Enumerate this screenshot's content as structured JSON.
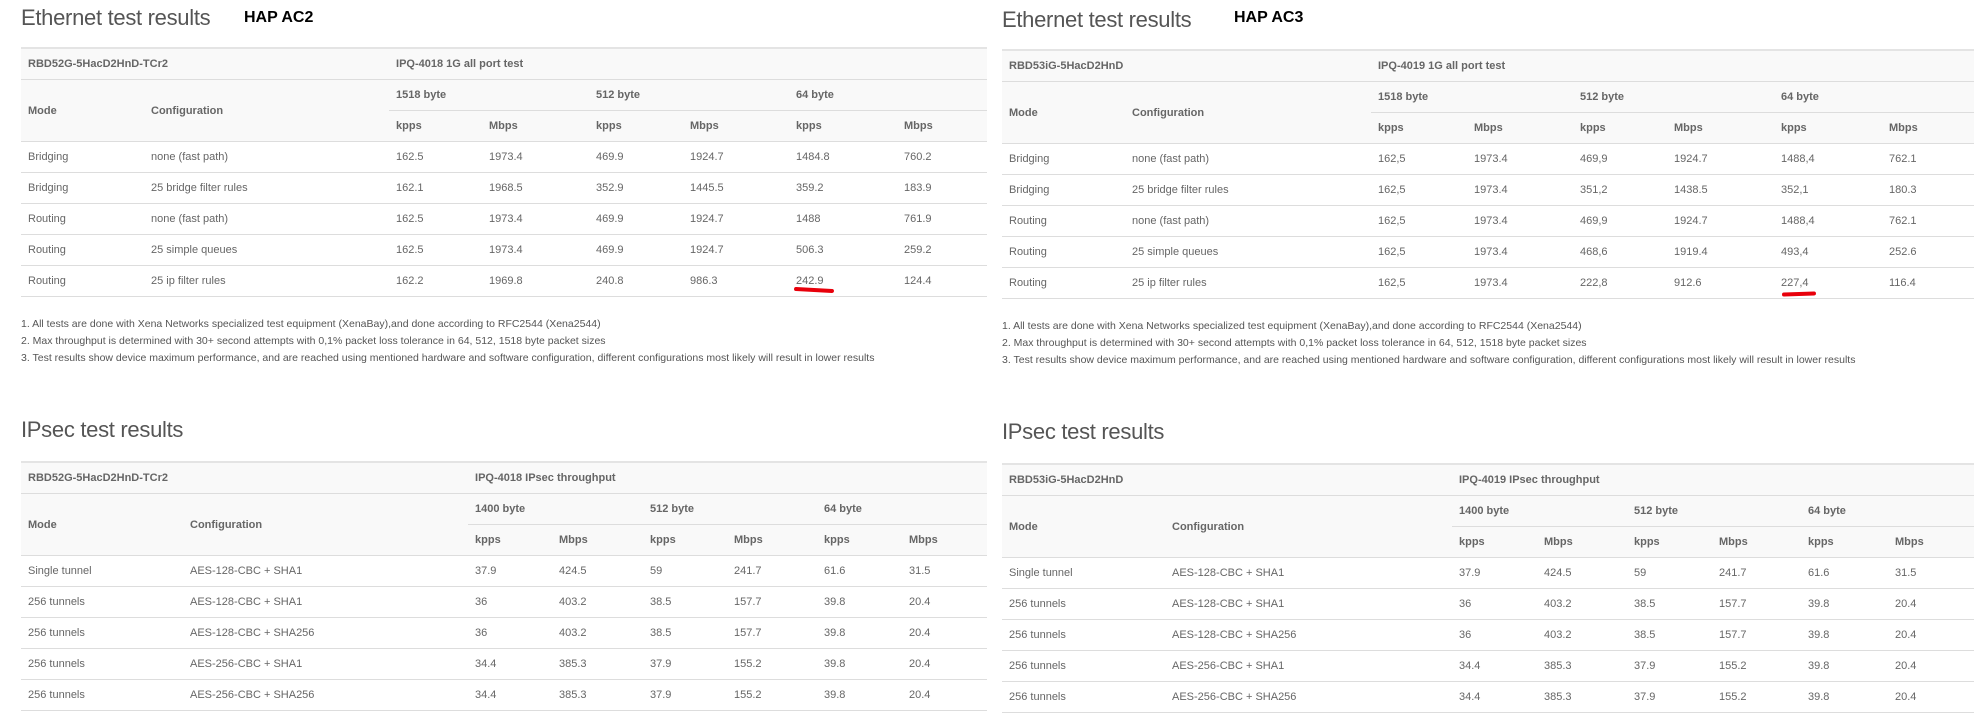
{
  "panels": [
    {
      "ethernet": {
        "title": "Ethernet test results",
        "model_label": "HAP AC2",
        "board": "RBD52G-5HacD2HnD-TCr2",
        "test_name": "IPQ-4018 1G all port test",
        "mode_header": "Mode",
        "config_header": "Configuration",
        "groups": [
          "1518 byte",
          "512 byte",
          "64 byte"
        ],
        "units": [
          "kpps",
          "Mbps",
          "kpps",
          "Mbps",
          "kpps",
          "Mbps"
        ],
        "rows": [
          [
            "Bridging",
            "none (fast path)",
            "162.5",
            "1973.4",
            "469.9",
            "1924.7",
            "1484.8",
            "760.2"
          ],
          [
            "Bridging",
            "25 bridge filter rules",
            "162.1",
            "1968.5",
            "352.9",
            "1445.5",
            "359.2",
            "183.9"
          ],
          [
            "Routing",
            "none (fast path)",
            "162.5",
            "1973.4",
            "469.9",
            "1924.7",
            "1488",
            "761.9"
          ],
          [
            "Routing",
            "25 simple queues",
            "162.5",
            "1973.4",
            "469.9",
            "1924.7",
            "506.3",
            "259.2"
          ],
          [
            "Routing",
            "25 ip filter rules",
            "162.2",
            "1969.8",
            "240.8",
            "986.3",
            "242.9",
            "124.4"
          ]
        ],
        "notes": [
          "1. All tests are done with Xena Networks specialized test equipment (XenaBay),and done according to RFC2544 (Xena2544)",
          "2. Max throughput is determined with 30+ second attempts with 0,1% packet loss tolerance in 64, 512, 1518 byte packet sizes",
          "3. Test results show device maximum performance, and are reached using mentioned hardware and software configuration, different configurations most likely will result in lower results"
        ]
      },
      "ipsec": {
        "title": "IPsec test results",
        "board": "RBD52G-5HacD2HnD-TCr2",
        "test_name": "IPQ-4018 IPsec throughput",
        "mode_header": "Mode",
        "config_header": "Configuration",
        "groups": [
          "1400 byte",
          "512 byte",
          "64 byte"
        ],
        "units": [
          "kpps",
          "Mbps",
          "kpps",
          "Mbps",
          "kpps",
          "Mbps"
        ],
        "rows": [
          [
            "Single tunnel",
            "AES-128-CBC + SHA1",
            "37.9",
            "424.5",
            "59",
            "241.7",
            "61.6",
            "31.5"
          ],
          [
            "256 tunnels",
            "AES-128-CBC + SHA1",
            "36",
            "403.2",
            "38.5",
            "157.7",
            "39.8",
            "20.4"
          ],
          [
            "256 tunnels",
            "AES-128-CBC + SHA256",
            "36",
            "403.2",
            "38.5",
            "157.7",
            "39.8",
            "20.4"
          ],
          [
            "256 tunnels",
            "AES-256-CBC + SHA1",
            "34.4",
            "385.3",
            "37.9",
            "155.2",
            "39.8",
            "20.4"
          ],
          [
            "256 tunnels",
            "AES-256-CBC + SHA256",
            "34.4",
            "385.3",
            "37.9",
            "155.2",
            "39.8",
            "20.4"
          ]
        ]
      }
    },
    {
      "ethernet": {
        "title": "Ethernet test results",
        "model_label": "HAP AC3",
        "board": "RBD53iG-5HacD2HnD",
        "test_name": "IPQ-4019 1G all port test",
        "mode_header": "Mode",
        "config_header": "Configuration",
        "groups": [
          "1518 byte",
          "512 byte",
          "64 byte"
        ],
        "units": [
          "kpps",
          "Mbps",
          "kpps",
          "Mbps",
          "kpps",
          "Mbps"
        ],
        "rows": [
          [
            "Bridging",
            "none (fast path)",
            "162,5",
            "1973.4",
            "469,9",
            "1924.7",
            "1488,4",
            "762.1"
          ],
          [
            "Bridging",
            "25 bridge filter rules",
            "162,5",
            "1973.4",
            "351,2",
            "1438.5",
            "352,1",
            "180.3"
          ],
          [
            "Routing",
            "none (fast path)",
            "162,5",
            "1973.4",
            "469,9",
            "1924.7",
            "1488,4",
            "762.1"
          ],
          [
            "Routing",
            "25 simple queues",
            "162,5",
            "1973.4",
            "468,6",
            "1919.4",
            "493,4",
            "252.6"
          ],
          [
            "Routing",
            "25 ip filter rules",
            "162,5",
            "1973.4",
            "222,8",
            "912.6",
            "227,4",
            "116.4"
          ]
        ],
        "notes": [
          "1. All tests are done with Xena Networks specialized test equipment (XenaBay),and done according to RFC2544 (Xena2544)",
          "2. Max throughput is determined with 30+ second attempts with 0,1% packet loss tolerance in 64, 512, 1518 byte packet sizes",
          "3. Test results show device maximum performance, and are reached using mentioned hardware and software configuration, different configurations most likely will result in lower results"
        ]
      },
      "ipsec": {
        "title": "IPsec test results",
        "board": "RBD53iG-5HacD2HnD",
        "test_name": "IPQ-4019 IPsec throughput",
        "mode_header": "Mode",
        "config_header": "Configuration",
        "groups": [
          "1400 byte",
          "512 byte",
          "64 byte"
        ],
        "units": [
          "kpps",
          "Mbps",
          "kpps",
          "Mbps",
          "kpps",
          "Mbps"
        ],
        "rows": [
          [
            "Single tunnel",
            "AES-128-CBC + SHA1",
            "37.9",
            "424.5",
            "59",
            "241.7",
            "61.6",
            "31.5"
          ],
          [
            "256 tunnels",
            "AES-128-CBC + SHA1",
            "36",
            "403.2",
            "38.5",
            "157.7",
            "39.8",
            "20.4"
          ],
          [
            "256 tunnels",
            "AES-128-CBC + SHA256",
            "36",
            "403.2",
            "38.5",
            "157.7",
            "39.8",
            "20.4"
          ],
          [
            "256 tunnels",
            "AES-256-CBC + SHA1",
            "34.4",
            "385.3",
            "37.9",
            "155.2",
            "39.8",
            "20.4"
          ],
          [
            "256 tunnels",
            "AES-256-CBC + SHA256",
            "34.4",
            "385.3",
            "37.9",
            "155.2",
            "39.8",
            "20.4"
          ]
        ]
      }
    }
  ],
  "colors": {
    "highlight_mark": "#e8000b",
    "header_bg": "#f9f9f9",
    "border": "#dddddd"
  }
}
